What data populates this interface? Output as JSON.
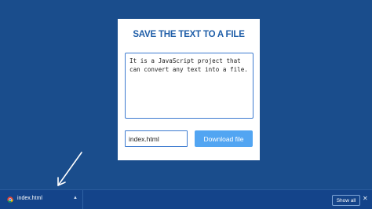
{
  "app": {
    "title": "SAVE THE TEXT TO A FILE",
    "textarea_value": "It is a JavaScript project that can convert any text into a file.",
    "filename_value": "index.html",
    "download_label": "Download file"
  },
  "downloads_bar": {
    "file_name": "index.html",
    "show_all_label": "Show all",
    "file_icon": "chrome-icon",
    "chevron_icon": "chevron-up-icon",
    "close_icon": "close-icon"
  },
  "annotation": {
    "icon": "arrow-icon"
  },
  "colors": {
    "background": "#1a4d8c",
    "card": "#ffffff",
    "title": "#1f5ea8",
    "accent": "#52a5f2",
    "downloads_bar": "#14448a"
  }
}
